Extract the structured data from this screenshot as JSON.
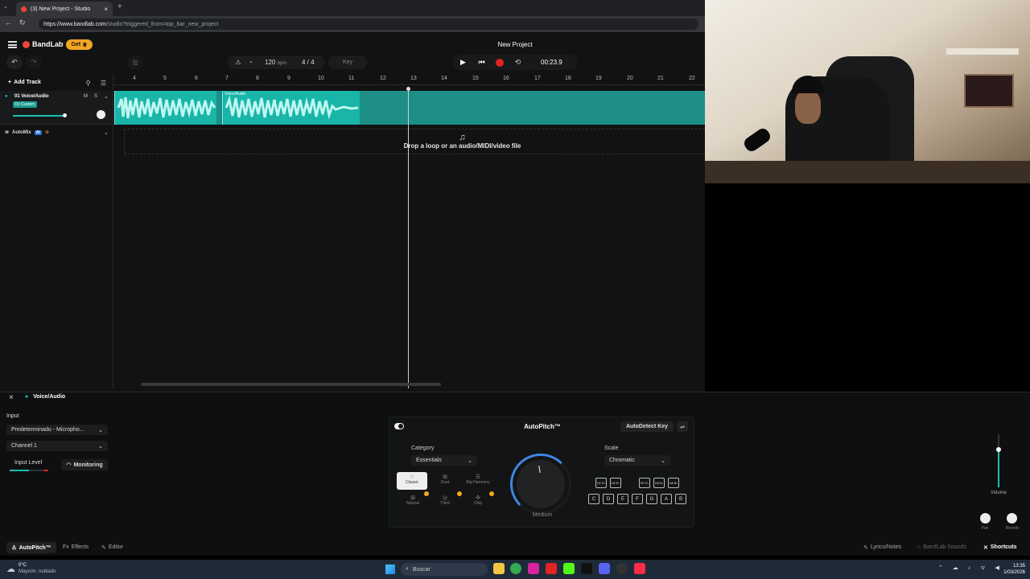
{
  "browser": {
    "tab_title": "(3) New Project - Studio",
    "url_domain": "https://www.bandlab.com",
    "url_path": "/studio?triggered_from=top_bar_new_project"
  },
  "header": {
    "logo": "BandLab",
    "get_badge": "Get",
    "project_title": "New Project"
  },
  "transport": {
    "bpm_value": "120",
    "bpm_unit": "bpm",
    "time_signature": "4 / 4",
    "key_label": "Key",
    "time": "00:23.9"
  },
  "timeline": {
    "bars": [
      "4",
      "5",
      "6",
      "7",
      "8",
      "9",
      "10",
      "11",
      "12",
      "13",
      "14",
      "15",
      "16",
      "17",
      "18",
      "19",
      "20",
      "21",
      "22"
    ]
  },
  "tracks": {
    "add_track": "Add Track",
    "track1_name": "01  Voice/Audio",
    "track1_fx": "Fx Custom",
    "mute": "M",
    "solo": "S",
    "clip1_name": "",
    "clip2_name": "Voice/Audio",
    "automix": "AutoMix",
    "ai_badge": "AI",
    "drop_hint": "Drop a loop or an audio/MIDI/video file"
  },
  "panel": {
    "track_label": "Voice/Audio",
    "input_heading": "Input",
    "input_device": "Predeterminado - Micropho...",
    "channel": "Channel 1",
    "input_level": "Input Level",
    "monitoring": "Monitoring",
    "volume": "Volume",
    "pan": "Pan",
    "reverb": "Reverb"
  },
  "autopitch": {
    "title": "AutoPitch™",
    "autodetect": "AutoDetect Key",
    "category_label": "Category",
    "category_value": "Essentials",
    "scale_label": "Scale",
    "scale_value": "Chromatic",
    "styles": [
      "Classic",
      "Duet",
      "Big Harmony",
      "Natural",
      "Third",
      "Chip"
    ],
    "knob_label": "Medium",
    "sharp_keys": [
      "C♯ D♭",
      "D♯ E♭",
      "F♯ G♭",
      "G♯ A♭",
      "A♯ B♭"
    ],
    "natural_keys": [
      "C",
      "D",
      "E",
      "F",
      "G",
      "A",
      "B"
    ]
  },
  "bottombar": {
    "tab_autopitch": "AutoPitch™",
    "tab_effects": "Effects",
    "tab_editor": "Editor",
    "lyrics": "Lyrics/Notes",
    "sounds": "BandLab Sounds",
    "shortcuts": "Shortcuts"
  },
  "taskbar": {
    "weather_temp": "0°C",
    "weather_desc": "Mayorm. nublado",
    "search": "Buscar",
    "clock_time": "13:35",
    "clock_date": "1/03/2026"
  },
  "colors": {
    "accent": "#18b5a8",
    "record": "#e02424",
    "get_badge": "#f5a623"
  }
}
